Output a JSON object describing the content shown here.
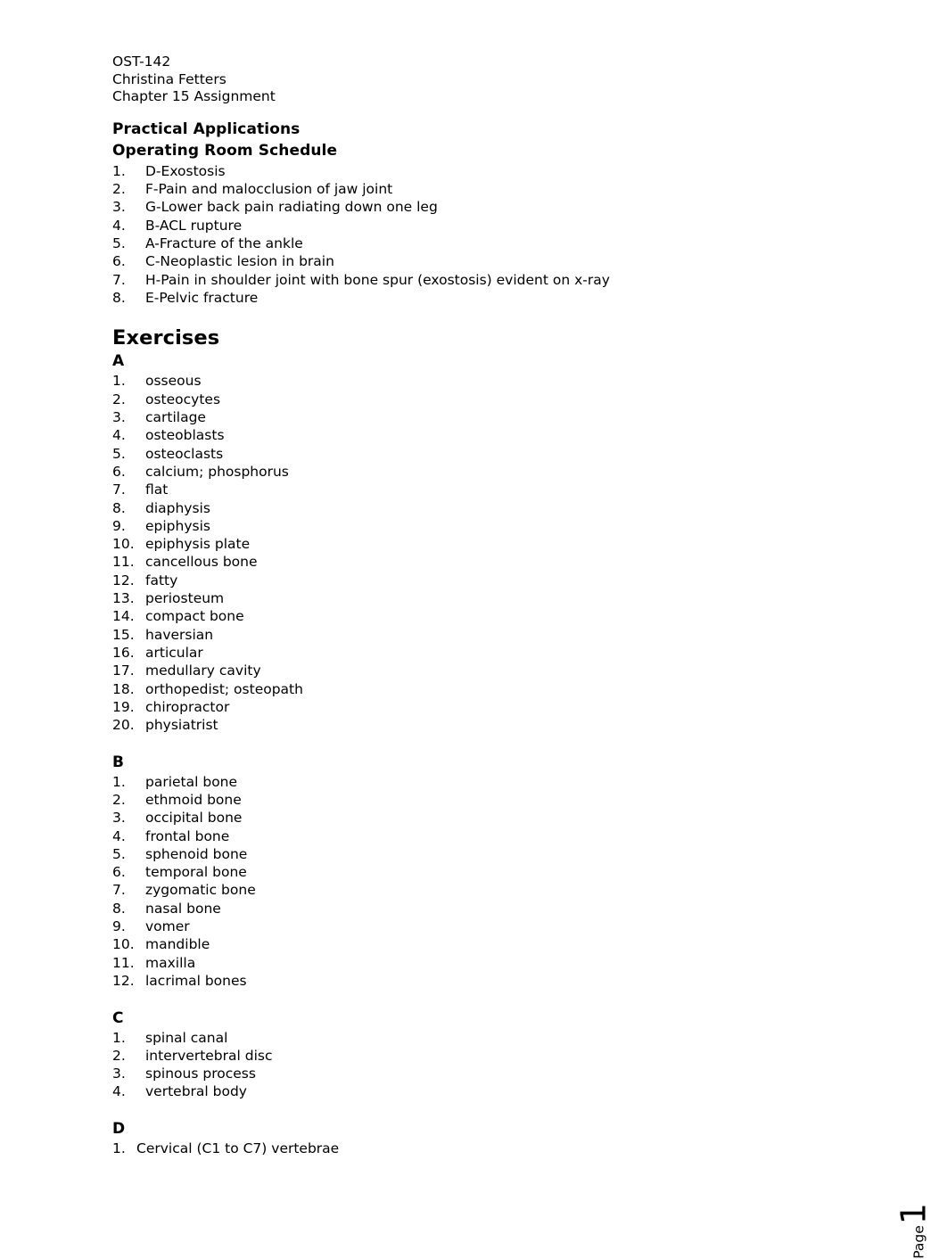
{
  "document": {
    "header_lines": [
      "OST-142",
      "Christina Fetters",
      "Chapter 15 Assignment"
    ],
    "practical_applications": {
      "heading": "Practical Applications",
      "subheading": "Operating Room Schedule",
      "items": [
        "D-Exostosis",
        "F-Pain and malocclusion of jaw joint",
        "G-Lower back pain radiating down one leg",
        "B-ACL rupture",
        "A-Fracture of the ankle",
        "C-Neoplastic lesion in brain",
        "H-Pain in shoulder joint with bone spur (exostosis) evident on x-ray",
        "E-Pelvic fracture"
      ]
    },
    "exercises": {
      "heading": "Exercises",
      "sections": [
        {
          "label": "A",
          "items": [
            "osseous",
            "osteocytes",
            "cartilage",
            "osteoblasts",
            "osteoclasts",
            "calcium; phosphorus",
            "flat",
            "diaphysis",
            "epiphysis",
            "epiphysis plate",
            "cancellous bone",
            "fatty",
            "periosteum",
            "compact bone",
            "haversian",
            "articular",
            "medullary cavity",
            "orthopedist; osteopath",
            "chiropractor",
            "physiatrist"
          ]
        },
        {
          "label": "B",
          "items": [
            "parietal bone",
            "ethmoid bone",
            "occipital bone",
            "frontal bone",
            "sphenoid bone",
            "temporal bone",
            "zygomatic bone",
            "nasal bone",
            "vomer",
            "mandible",
            "maxilla",
            "lacrimal bones"
          ]
        },
        {
          "label": "C",
          "items": [
            "spinal canal",
            "intervertebral disc",
            "spinous process",
            "vertebral body"
          ]
        },
        {
          "label": "D",
          "items": [
            "Cervical (C1 to C7) vertebrae"
          ]
        }
      ]
    },
    "footer": {
      "page_label": "Page",
      "page_number": "1"
    }
  }
}
